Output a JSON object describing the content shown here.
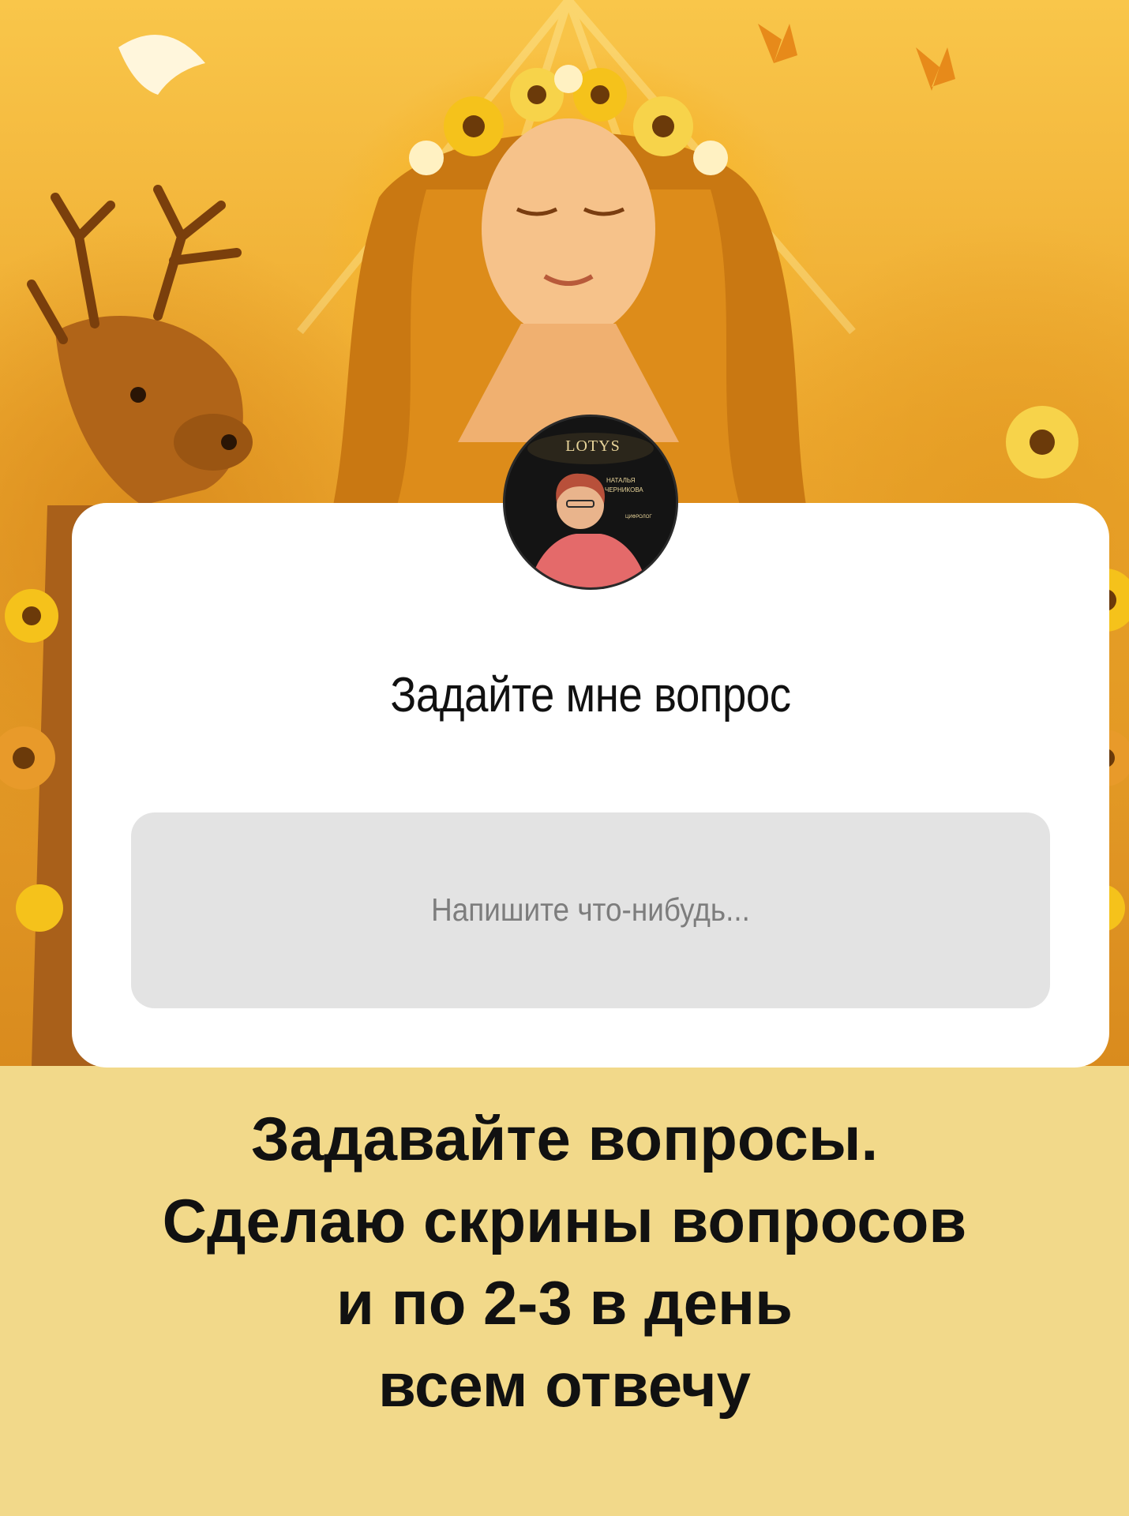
{
  "background_art": {
    "icon": "sun-goddess-illustration"
  },
  "profile": {
    "avatar_brand": "LOTYS",
    "avatar_name_line1": "НАТАЛЬЯ",
    "avatar_name_line2": "ЧЕРНИКОВА",
    "avatar_role": "ЦИФРОЛОГ"
  },
  "question_sticker": {
    "title": "Задайте мне вопрос",
    "placeholder": "Напишите что-нибудь..."
  },
  "caption": {
    "lines": [
      "Задавайте вопросы.",
      "Сделаю скрины вопросов",
      "и по 2-3 в день",
      "всем отвечу"
    ]
  },
  "colors": {
    "caption_band": "#f2d98a",
    "sticker_bg": "#ffffff",
    "input_bg": "#e3e3e3"
  }
}
